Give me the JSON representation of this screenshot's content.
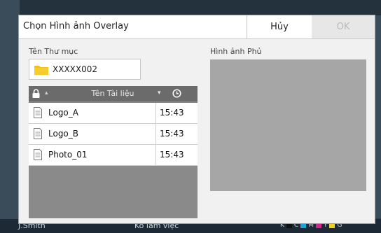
{
  "background": {
    "user": "J.Smith",
    "status": "Ko làm việc",
    "ink": [
      "K",
      "C",
      "M",
      "Y",
      "G"
    ]
  },
  "dialog": {
    "title": "Chọn Hình ảnh Overlay",
    "cancel_label": "Hủy",
    "ok_label": "OK",
    "folder_label": "Tên Thư mục",
    "folder_name": "XXXXX002",
    "overlay_label": "Hình ảnh Phủ",
    "list": {
      "column_name": "Tên Tài liệu",
      "rows": [
        {
          "name": "Logo_A",
          "time": "15:43"
        },
        {
          "name": "Logo_B",
          "time": "15:43"
        },
        {
          "name": "Photo_01",
          "time": "15:43"
        }
      ]
    }
  },
  "colors": {
    "accent_folder": "#f2c011",
    "header_bar": "#6b6b6b",
    "preview": "#a6a6a6"
  }
}
